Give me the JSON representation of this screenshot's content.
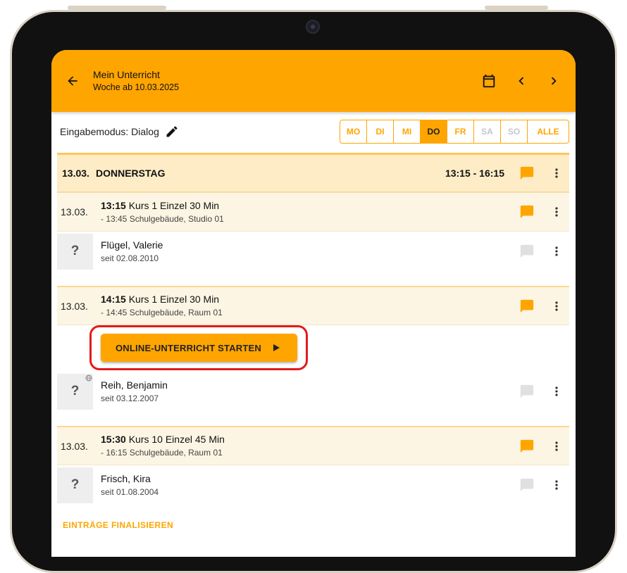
{
  "header": {
    "title": "Mein Unterricht",
    "subtitle": "Woche ab 10.03.2025",
    "back_icon": "arrow-left-icon",
    "calendar_icon": "calendar-icon",
    "prev_icon": "chevron-left-icon",
    "next_icon": "chevron-right-icon"
  },
  "toolbar": {
    "mode_label": "Eingabemodus: Dialog",
    "edit_icon": "pencil-icon",
    "days": [
      {
        "label": "MO",
        "state": "enabled"
      },
      {
        "label": "DI",
        "state": "enabled"
      },
      {
        "label": "MI",
        "state": "enabled"
      },
      {
        "label": "DO",
        "state": "active"
      },
      {
        "label": "FR",
        "state": "enabled"
      },
      {
        "label": "SA",
        "state": "disabled"
      },
      {
        "label": "SO",
        "state": "disabled"
      },
      {
        "label": "ALLE",
        "state": "enabled"
      }
    ]
  },
  "day_header": {
    "date": "13.03.",
    "weekday": "DONNERSTAG",
    "time_range": "13:15 - 16:15"
  },
  "lessons": [
    {
      "date": "13.03.",
      "start": "13:15",
      "title": "Kurs 1 Einzel 30 Min",
      "details": "- 13:45 Schulgebäude, Studio 01",
      "student": {
        "avatar": "?",
        "name": "Flügel, Valerie",
        "since": "seit 02.08.2010",
        "online": false
      }
    },
    {
      "date": "13.03.",
      "start": "14:15",
      "title": "Kurs 1 Einzel 30 Min",
      "details": "- 14:45 Schulgebäude, Raum 01",
      "online_button": "ONLINE-UNTERRICHT STARTEN",
      "student": {
        "avatar": "?",
        "name": "Reih, Benjamin",
        "since": "seit 03.12.2007",
        "online": true
      }
    },
    {
      "date": "13.03.",
      "start": "15:30",
      "title": "Kurs 10 Einzel 45 Min",
      "details": "- 16:15 Schulgebäude, Raum 01",
      "student": {
        "avatar": "?",
        "name": "Frisch, Kira",
        "since": "seit 01.08.2004",
        "online": false
      }
    }
  ],
  "finalize_label": "EINTRÄGE FINALISIEREN",
  "colors": {
    "accent": "#ffa500",
    "day_header_bg": "#fdecc6",
    "lesson_bg": "#fdf5e3",
    "highlight": "#e21b1b",
    "chat_inactive": "#e0e0e0"
  }
}
